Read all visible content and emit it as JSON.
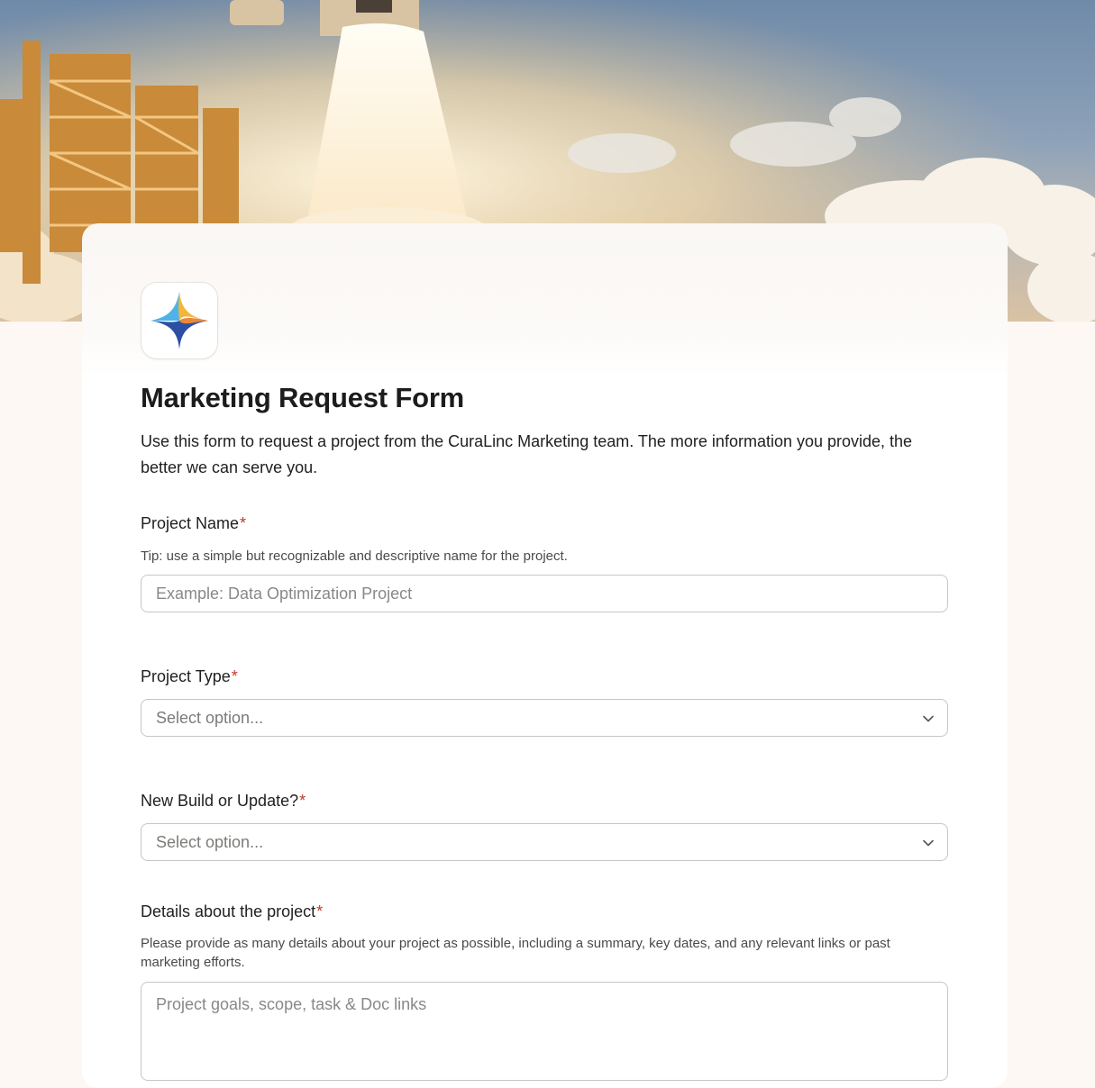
{
  "form": {
    "title": "Marketing Request Form",
    "description": "Use this form to request a project from the CuraLinc Marketing team. The more information you provide, the better we can serve you.",
    "required_marker": "*",
    "fields": {
      "project_name": {
        "label": "Project Name",
        "hint": "Tip: use a simple but recognizable and descriptive name for the project.",
        "placeholder": "Example: Data Optimization Project"
      },
      "project_type": {
        "label": "Project Type",
        "selected": "Select option..."
      },
      "new_build": {
        "label": "New Build or Update?",
        "selected": "Select option..."
      },
      "details": {
        "label": "Details about the project",
        "hint": "Please provide as many details about your project as possible, including a summary, key dates, and any relevant links or past marketing efforts.",
        "placeholder": "Project goals, scope, task & Doc links"
      }
    }
  },
  "icons": {
    "logo": "curalinc-star-logo",
    "dropdown": "chevron-down-icon"
  },
  "colors": {
    "required": "#c0392b",
    "logo_light_blue": "#4fb3e8",
    "logo_dark_blue": "#2d4fa3",
    "logo_yellow": "#f2b63c",
    "logo_orange": "#e8893a"
  }
}
